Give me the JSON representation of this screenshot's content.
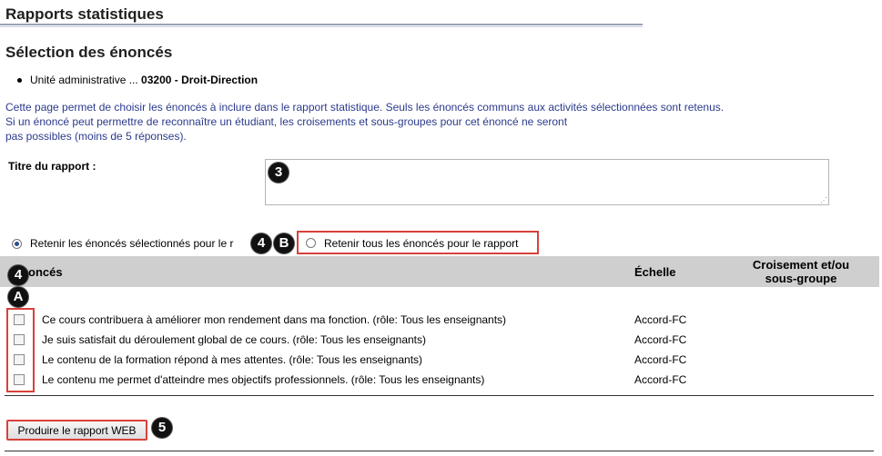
{
  "header": {
    "title": "Rapports statistiques"
  },
  "section": {
    "title": "Sélection des énoncés"
  },
  "unit": {
    "label": "Unité administrative ... ",
    "code": "03200",
    "separator": " - ",
    "name": "Droit-Direction"
  },
  "info": {
    "line1": "Cette page permet de choisir les énoncés à inclure dans le rapport statistique. Seuls les énoncés communs aux activités sélectionnées sont retenus.",
    "line2": "Si un énoncé peut permettre de reconnaître un étudiant, les croisements et sous-groupes pour cet énoncé ne seront",
    "line3": "pas possibles (moins de 5 réponses)."
  },
  "report": {
    "label": "Titre du rapport :",
    "value": ""
  },
  "options": {
    "selected_label": "Retenir les énoncés sélectionnés pour le r",
    "selected_checked": true,
    "all_label": "Retenir tous les énoncés pour le rapport",
    "all_checked": false
  },
  "annotations": {
    "n3": "3",
    "n4a": "4",
    "b": "B",
    "n4b": "4",
    "a": "A",
    "n5": "5"
  },
  "table": {
    "col_statements": "oncés",
    "col_scale": "Échelle",
    "col_cross_line1": "Croisement et/ou",
    "col_cross_line2": "sous-groupe",
    "rows": [
      {
        "text": "Ce cours contribuera à améliorer mon rendement dans ma fonction. (rôle: Tous les enseignants)",
        "scale": "Accord-FC",
        "checked": false
      },
      {
        "text": "Je suis satisfait du déroulement global de ce cours. (rôle: Tous les enseignants)",
        "scale": "Accord-FC",
        "checked": false
      },
      {
        "text": "Le contenu de la formation répond à mes attentes. (rôle: Tous les enseignants)",
        "scale": "Accord-FC",
        "checked": false
      },
      {
        "text": "Le contenu me permet d'atteindre mes objectifs professionnels. (rôle: Tous les enseignants)",
        "scale": "Accord-FC",
        "checked": false
      }
    ]
  },
  "button": {
    "label": "Produire le rapport WEB"
  },
  "colors": {
    "highlight": "#d9413b",
    "info_text": "#2b3a8c",
    "header_bg": "#cfcfcf"
  }
}
